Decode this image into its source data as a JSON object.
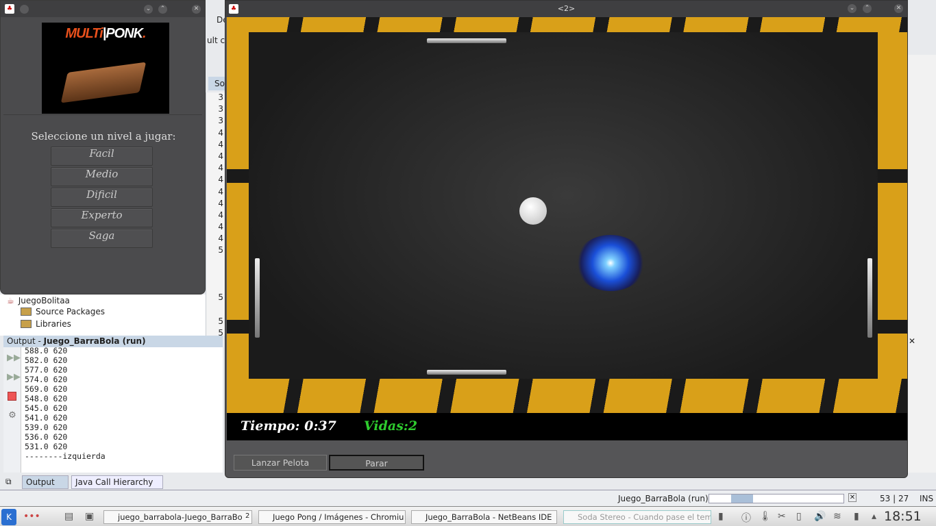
{
  "netbeans": {
    "menu_fragment": "De",
    "toolbar_fragment": "ult c",
    "tab_fragment": "So",
    "line_numbers": [
      "3",
      "3",
      "3",
      "4",
      "4",
      "4",
      "4",
      "4",
      "4",
      "4",
      "4",
      "4",
      "4",
      "5",
      "",
      "",
      "",
      "5",
      "",
      "5",
      "5"
    ],
    "tree": [
      {
        "label": "JuegoBolitaa"
      },
      {
        "label": "Source Packages"
      },
      {
        "label": "Libraries"
      }
    ],
    "output": {
      "title_prefix": "Output - ",
      "title_run": "Juego_BarraBola (run)",
      "lines": [
        "588.0 620",
        "582.0 620",
        "577.0 620",
        "574.0 620",
        "569.0 620",
        "548.0 620",
        "545.0 620",
        "541.0 620",
        "539.0 620",
        "536.0 620",
        "531.0 620",
        "--------izquierda"
      ]
    },
    "bottom_tabs": [
      {
        "label": "Output"
      },
      {
        "label": "Java Call Hierarchy"
      }
    ],
    "status": {
      "run_label": "Juego_BarraBola (run)",
      "position": "53 | 27",
      "mode": "INS"
    }
  },
  "menu_window": {
    "logo_text": "MULTi|PONK.",
    "prompt": "Seleccione un nivel a jugar:",
    "levels": [
      "Facil",
      "Medio",
      "Dificil",
      "Experto",
      "Saga"
    ]
  },
  "game_window": {
    "title": "<2>",
    "hud": {
      "time_label": "Tiempo: 0:37",
      "lives_label": "Vidas:2",
      "lives_color": "#2ecc2e"
    },
    "buttons": {
      "launch": "Lanzar Pelota",
      "stop": "Parar"
    }
  },
  "taskbar": {
    "tasks": [
      "juego_barrabola-Juego_BarraBo",
      "Juego Pong / Imágenes - Chromiu",
      "Juego_BarraBola - NetBeans IDE",
      "Soda Stereo - Cuando pase el tem"
    ],
    "task_counter": "2",
    "clock": "18:51"
  }
}
